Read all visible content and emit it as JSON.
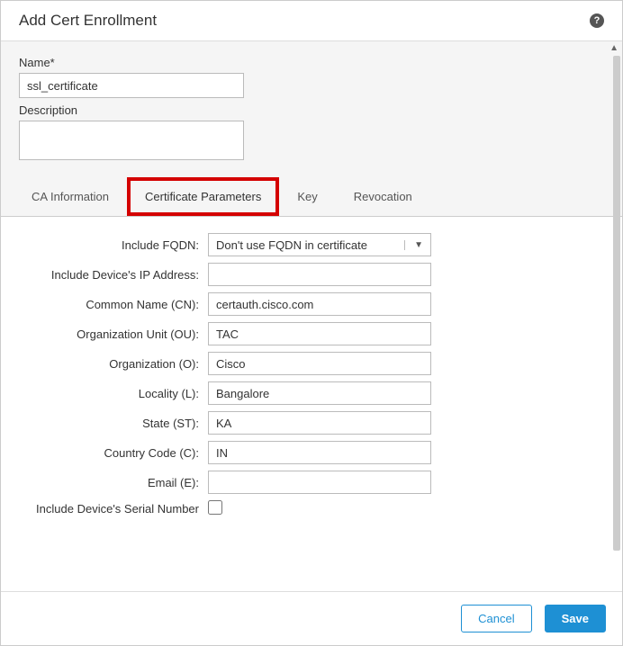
{
  "dialog": {
    "title": "Add Cert Enrollment"
  },
  "top": {
    "name_label": "Name*",
    "name_value": "ssl_certificate",
    "description_label": "Description",
    "description_value": ""
  },
  "tabs": {
    "ca_info": "CA Information",
    "cert_params": "Certificate Parameters",
    "key": "Key",
    "revocation": "Revocation",
    "active": "cert_params"
  },
  "cert_params": {
    "include_fqdn_label": "Include FQDN:",
    "include_fqdn_value": "Don't use FQDN in certificate",
    "include_ip_label": "Include Device's IP Address:",
    "include_ip_value": "",
    "cn_label": "Common Name (CN):",
    "cn_value": "certauth.cisco.com",
    "ou_label": "Organization Unit (OU):",
    "ou_value": "TAC",
    "o_label": "Organization (O):",
    "o_value": "Cisco",
    "locality_label": "Locality (L):",
    "locality_value": "Bangalore",
    "state_label": "State (ST):",
    "state_value": "KA",
    "country_label": "Country Code (C):",
    "country_value": "IN",
    "email_label": "Email (E):",
    "email_value": "",
    "serial_label": "Include Device's Serial Number",
    "serial_checked": false
  },
  "footer": {
    "cancel": "Cancel",
    "save": "Save"
  }
}
